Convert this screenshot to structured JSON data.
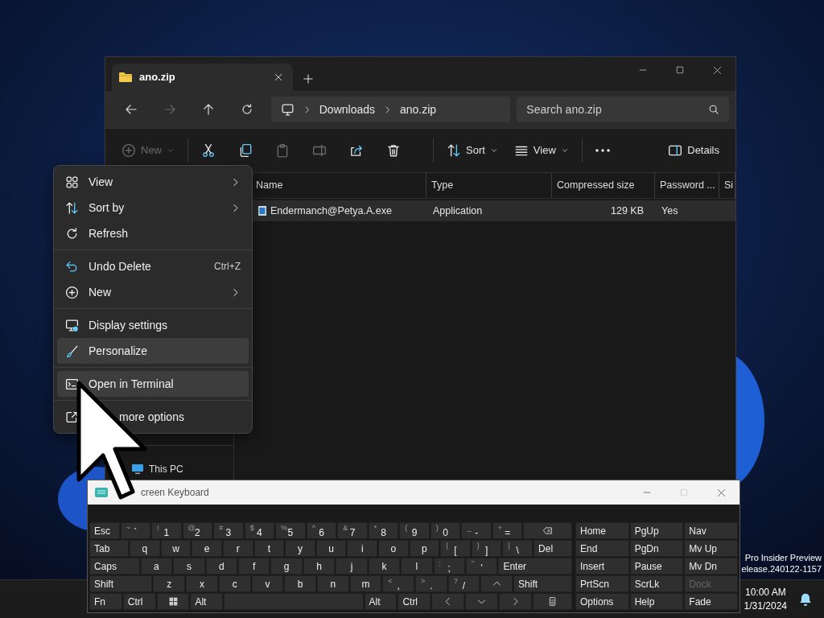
{
  "explorer": {
    "tab": {
      "title": "ano.zip"
    },
    "nav": [
      {
        "kind": "back",
        "disabled": false
      },
      {
        "kind": "forward",
        "disabled": true
      },
      {
        "kind": "up",
        "disabled": false
      },
      {
        "kind": "refresh",
        "disabled": false
      }
    ],
    "breadcrumb": [
      "Downloads",
      "ano.zip"
    ],
    "search": {
      "placeholder": "Search ano.zip"
    },
    "toolbar": [
      {
        "kind": "new",
        "label": "New",
        "disabled": true
      },
      {
        "kind": "cut",
        "disabled": false
      },
      {
        "kind": "copy",
        "disabled": false
      },
      {
        "kind": "paste",
        "disabled": true
      },
      {
        "kind": "rename",
        "disabled": true
      },
      {
        "kind": "share",
        "disabled": false
      },
      {
        "kind": "delete",
        "disabled": false
      },
      {
        "kind": "sort",
        "label": "Sort",
        "disabled": false
      },
      {
        "kind": "view",
        "label": "View",
        "disabled": false
      },
      {
        "kind": "more",
        "disabled": false
      }
    ],
    "details_button": "Details",
    "columns": [
      "Name",
      "Type",
      "Compressed size",
      "Password ...",
      "Si"
    ],
    "rows": [
      {
        "cells": [
          "Endermanch@Petya.A.exe",
          "Application",
          "129 KB",
          "Yes"
        ],
        "selected": true
      }
    ],
    "sidebar": [
      {
        "label": "This PC"
      }
    ]
  },
  "context_menu": {
    "groups": [
      [
        {
          "kind": "view",
          "label": "View",
          "submenu": true,
          "highlighted": false
        },
        {
          "kind": "sort",
          "label": "Sort by",
          "submenu": true,
          "highlighted": false
        },
        {
          "kind": "refresh",
          "label": "Refresh",
          "submenu": false,
          "highlighted": false
        }
      ],
      [
        {
          "kind": "undo",
          "label": "Undo Delete",
          "shortcut": "Ctrl+Z",
          "submenu": false,
          "highlighted": false
        },
        {
          "kind": "new",
          "label": "New",
          "submenu": true,
          "highlighted": false
        }
      ],
      [
        {
          "kind": "display",
          "label": "Display settings",
          "submenu": false,
          "highlighted": false
        },
        {
          "kind": "personalize",
          "label": "Personalize",
          "submenu": false,
          "highlighted": true
        }
      ],
      [
        {
          "kind": "terminal",
          "label": "Open in Terminal",
          "submenu": false,
          "highlighted": true
        }
      ],
      [
        {
          "kind": "more",
          "label": "more options",
          "submenu": false,
          "highlighted": false
        }
      ]
    ]
  },
  "keyboard": {
    "title": "creen Keyboard",
    "main_rows": [
      [
        {
          "kind": "text",
          "label": "Esc"
        },
        {
          "kind": "pair",
          "shift": "~",
          "label": "`"
        },
        {
          "kind": "pair",
          "shift": "!",
          "label": "1"
        },
        {
          "kind": "pair",
          "shift": "@",
          "label": "2"
        },
        {
          "kind": "pair",
          "shift": "#",
          "label": "3"
        },
        {
          "kind": "pair",
          "shift": "$",
          "label": "4"
        },
        {
          "kind": "pair",
          "shift": "%",
          "label": "5"
        },
        {
          "kind": "pair",
          "shift": "^",
          "label": "6"
        },
        {
          "kind": "pair",
          "shift": "&",
          "label": "7"
        },
        {
          "kind": "pair",
          "shift": "*",
          "label": "8"
        },
        {
          "kind": "pair",
          "shift": "(",
          "label": "9"
        },
        {
          "kind": "pair",
          "shift": ")",
          "label": "0"
        },
        {
          "kind": "pair",
          "shift": "_",
          "label": "-"
        },
        {
          "kind": "pair",
          "shift": "+",
          "label": "="
        },
        {
          "kind": "backspace"
        }
      ],
      [
        {
          "kind": "text",
          "label": "Tab"
        },
        {
          "kind": "char",
          "label": "q"
        },
        {
          "kind": "char",
          "label": "w"
        },
        {
          "kind": "char",
          "label": "e"
        },
        {
          "kind": "char",
          "label": "r"
        },
        {
          "kind": "char",
          "label": "t"
        },
        {
          "kind": "char",
          "label": "y"
        },
        {
          "kind": "char",
          "label": "u"
        },
        {
          "kind": "char",
          "label": "i"
        },
        {
          "kind": "char",
          "label": "o"
        },
        {
          "kind": "char",
          "label": "p"
        },
        {
          "kind": "pair",
          "shift": "{",
          "label": "["
        },
        {
          "kind": "pair",
          "shift": "}",
          "label": "]"
        },
        {
          "kind": "pair",
          "shift": "|",
          "label": "\\"
        },
        {
          "kind": "text",
          "label": "Del"
        }
      ],
      [
        {
          "kind": "text",
          "label": "Caps"
        },
        {
          "kind": "char",
          "label": "a"
        },
        {
          "kind": "char",
          "label": "s"
        },
        {
          "kind": "char",
          "label": "d"
        },
        {
          "kind": "char",
          "label": "f"
        },
        {
          "kind": "char",
          "label": "g"
        },
        {
          "kind": "char",
          "label": "h"
        },
        {
          "kind": "char",
          "label": "j"
        },
        {
          "kind": "char",
          "label": "k"
        },
        {
          "kind": "char",
          "label": "l"
        },
        {
          "kind": "pair",
          "shift": ":",
          "label": ";"
        },
        {
          "kind": "pair",
          "shift": "\"",
          "label": "'"
        },
        {
          "kind": "text",
          "label": "Enter"
        }
      ],
      [
        {
          "kind": "text",
          "label": "Shift"
        },
        {
          "kind": "char",
          "label": "z"
        },
        {
          "kind": "char",
          "label": "x"
        },
        {
          "kind": "char",
          "label": "c"
        },
        {
          "kind": "char",
          "label": "v"
        },
        {
          "kind": "char",
          "label": "b"
        },
        {
          "kind": "char",
          "label": "n"
        },
        {
          "kind": "char",
          "label": "m"
        },
        {
          "kind": "pair",
          "shift": "<",
          "label": ","
        },
        {
          "kind": "pair",
          "shift": ">",
          "label": "."
        },
        {
          "kind": "pair",
          "shift": "?",
          "label": "/"
        },
        {
          "kind": "up"
        },
        {
          "kind": "text",
          "label": "Shift"
        }
      ],
      [
        {
          "kind": "text",
          "label": "Fn"
        },
        {
          "kind": "text",
          "label": "Ctrl"
        },
        {
          "kind": "windows"
        },
        {
          "kind": "text",
          "label": "Alt"
        },
        {
          "kind": "space"
        },
        {
          "kind": "text",
          "label": "Alt"
        },
        {
          "kind": "text",
          "label": "Ctrl"
        },
        {
          "kind": "left"
        },
        {
          "kind": "down"
        },
        {
          "kind": "right"
        },
        {
          "kind": "menu"
        }
      ]
    ],
    "side_rows": [
      [
        {
          "label": "Home",
          "disabled": false
        },
        {
          "label": "PgUp",
          "disabled": false
        },
        {
          "label": "Nav",
          "disabled": false
        }
      ],
      [
        {
          "label": "End",
          "disabled": false
        },
        {
          "label": "PgDn",
          "disabled": false
        },
        {
          "label": "Mv Up",
          "disabled": false
        }
      ],
      [
        {
          "label": "Insert",
          "disabled": false
        },
        {
          "label": "Pause",
          "disabled": false
        },
        {
          "label": "Mv Dn",
          "disabled": false
        }
      ],
      [
        {
          "label": "PrtScn",
          "disabled": false
        },
        {
          "label": "ScrLk",
          "disabled": false
        },
        {
          "label": "Dock",
          "disabled": true
        }
      ],
      [
        {
          "label": "Options",
          "disabled": false
        },
        {
          "label": "Help",
          "disabled": false
        },
        {
          "label": "Fade",
          "disabled": false
        }
      ]
    ]
  },
  "desktop": {
    "build_lines": [
      "Pro Insider Preview",
      "elease.240122-1157"
    ]
  },
  "taskbar": {
    "time": "10:00 AM",
    "date": "1/31/2024"
  }
}
